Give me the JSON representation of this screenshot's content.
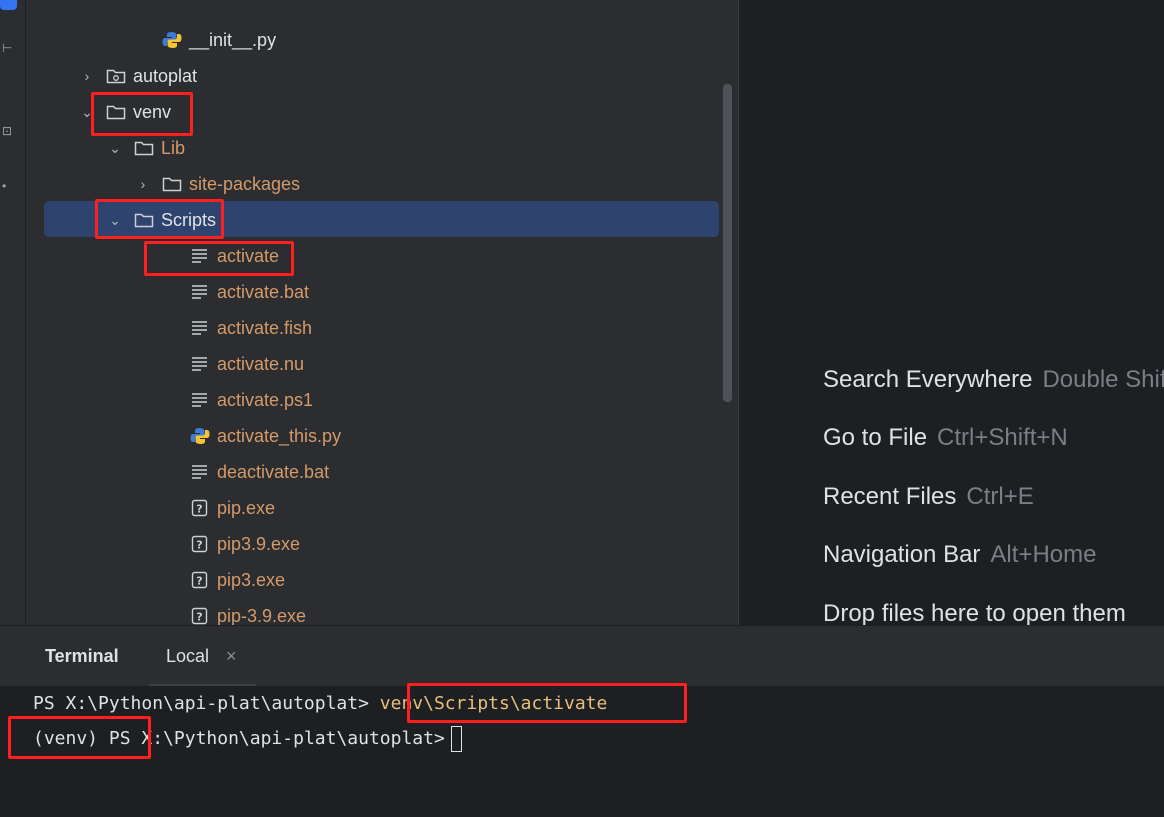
{
  "left_strip": {
    "glyphs": [
      "⊢",
      "⊡",
      "•"
    ]
  },
  "tree": {
    "items": [
      {
        "label": "__init__.py",
        "icon": "python-file-icon",
        "chevron": "",
        "color": "white",
        "depth": 3
      },
      {
        "label": "autoplat",
        "icon": "module-folder-icon",
        "chevron": "›",
        "color": "white",
        "depth": 1
      },
      {
        "label": "venv",
        "icon": "folder-icon",
        "chevron": "⌄",
        "color": "white",
        "depth": 1
      },
      {
        "label": "Lib",
        "icon": "folder-icon",
        "chevron": "⌄",
        "color": "orange",
        "depth": 2
      },
      {
        "label": "site-packages",
        "icon": "folder-icon",
        "chevron": "›",
        "color": "orange",
        "depth": 3
      },
      {
        "label": "Scripts",
        "icon": "folder-icon",
        "chevron": "⌄",
        "color": "white",
        "depth": 2,
        "selected": true
      },
      {
        "label": "activate",
        "icon": "text-file-icon",
        "chevron": "",
        "color": "orange",
        "depth": 4
      },
      {
        "label": "activate.bat",
        "icon": "text-file-icon",
        "chevron": "",
        "color": "orange",
        "depth": 4
      },
      {
        "label": "activate.fish",
        "icon": "text-file-icon",
        "chevron": "",
        "color": "orange",
        "depth": 4
      },
      {
        "label": "activate.nu",
        "icon": "text-file-icon",
        "chevron": "",
        "color": "orange",
        "depth": 4
      },
      {
        "label": "activate.ps1",
        "icon": "text-file-icon",
        "chevron": "",
        "color": "orange",
        "depth": 4
      },
      {
        "label": "activate_this.py",
        "icon": "python-file-icon",
        "chevron": "",
        "color": "orange",
        "depth": 4
      },
      {
        "label": "deactivate.bat",
        "icon": "text-file-icon",
        "chevron": "",
        "color": "orange",
        "depth": 4
      },
      {
        "label": "pip.exe",
        "icon": "unknown-file-icon",
        "chevron": "",
        "color": "orange",
        "depth": 4
      },
      {
        "label": "pip3.9.exe",
        "icon": "unknown-file-icon",
        "chevron": "",
        "color": "orange",
        "depth": 4
      },
      {
        "label": "pip3.exe",
        "icon": "unknown-file-icon",
        "chevron": "",
        "color": "orange",
        "depth": 4
      },
      {
        "label": "pip-3.9.exe",
        "icon": "unknown-file-icon",
        "chevron": "",
        "color": "orange",
        "depth": 4
      }
    ]
  },
  "editor": {
    "hints": [
      {
        "text": "Search Everywhere",
        "shortcut": "Double Shift"
      },
      {
        "text": "Go to File",
        "shortcut": "Ctrl+Shift+N"
      },
      {
        "text": "Recent Files",
        "shortcut": "Ctrl+E"
      },
      {
        "text": "Navigation Bar",
        "shortcut": "Alt+Home"
      },
      {
        "text": "Drop files here to open them",
        "shortcut": ""
      }
    ]
  },
  "terminal": {
    "title": "Terminal",
    "tab_label": "Local",
    "close_glyph": "×",
    "line1_prompt": "PS X:\\Python\\api-plat\\autoplat> ",
    "line1_command": "venv\\Scripts\\activate",
    "line2_env": "(venv) PS",
    "line2_path": " X:\\Python\\api-plat\\autoplat>"
  },
  "colors": {
    "highlight_box": "#ff1f1f",
    "selection": "#2e436e",
    "excluded_label": "#d49a6a",
    "command_text": "#e5c07b"
  }
}
